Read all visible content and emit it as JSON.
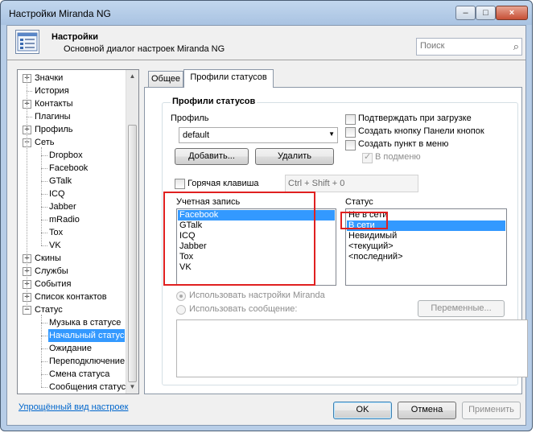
{
  "window": {
    "title": "Настройки Miranda NG",
    "minimize_glyph": "–",
    "maximize_glyph": "□",
    "close_glyph": "×"
  },
  "header": {
    "title": "Настройки",
    "subtitle": "Основной диалог настроек Miranda NG",
    "search_placeholder": "Поиск",
    "search_icon": "⌕"
  },
  "tree": {
    "items": [
      {
        "label": "Значки",
        "level": 0,
        "expander": "+"
      },
      {
        "label": "История",
        "level": 0,
        "expander": ""
      },
      {
        "label": "Контакты",
        "level": 0,
        "expander": "+"
      },
      {
        "label": "Плагины",
        "level": 0,
        "expander": ""
      },
      {
        "label": "Профиль",
        "level": 0,
        "expander": "+"
      },
      {
        "label": "Сеть",
        "level": 0,
        "expander": "−"
      },
      {
        "label": "Dropbox",
        "level": 1,
        "expander": ""
      },
      {
        "label": "Facebook",
        "level": 1,
        "expander": ""
      },
      {
        "label": "GTalk",
        "level": 1,
        "expander": ""
      },
      {
        "label": "ICQ",
        "level": 1,
        "expander": ""
      },
      {
        "label": "Jabber",
        "level": 1,
        "expander": ""
      },
      {
        "label": "mRadio",
        "level": 1,
        "expander": ""
      },
      {
        "label": "Tox",
        "level": 1,
        "expander": ""
      },
      {
        "label": "VK",
        "level": 1,
        "expander": ""
      },
      {
        "label": "Скины",
        "level": 0,
        "expander": "+"
      },
      {
        "label": "Службы",
        "level": 0,
        "expander": "+"
      },
      {
        "label": "События",
        "level": 0,
        "expander": "+"
      },
      {
        "label": "Список контактов",
        "level": 0,
        "expander": "+"
      },
      {
        "label": "Статус",
        "level": 0,
        "expander": "−"
      },
      {
        "label": "Музыка в статусе",
        "level": 1,
        "expander": ""
      },
      {
        "label": "Начальный статус",
        "level": 1,
        "expander": "",
        "selected": true
      },
      {
        "label": "Ожидание",
        "level": 1,
        "expander": ""
      },
      {
        "label": "Переподключение",
        "level": 1,
        "expander": ""
      },
      {
        "label": "Смена статуса",
        "level": 1,
        "expander": ""
      },
      {
        "label": "Сообщения статуса",
        "level": 1,
        "expander": ""
      }
    ],
    "scroll_up": "▲",
    "scroll_down": "▼"
  },
  "tabs": [
    {
      "label": "Общее",
      "active": false
    },
    {
      "label": "Профили статусов",
      "active": true
    }
  ],
  "group": {
    "title": "Профили статусов",
    "profile_label": "Профиль",
    "profile_value": "default",
    "add_button": "Добавить...",
    "delete_button": "Удалить",
    "confirm_on_load": {
      "label": "Подтверждать при загрузке",
      "checked": false
    },
    "create_toolbar_button": {
      "label": "Создать кнопку Панели кнопок",
      "checked": false
    },
    "create_menu_item": {
      "label": "Создать пункт в меню",
      "checked": false
    },
    "in_submenu": {
      "label": "В подменю",
      "checked": true,
      "disabled": true
    },
    "hotkey": {
      "label": "Горячая клавиша",
      "checked": false,
      "value": "Ctrl + Shift + 0"
    },
    "account_label": "Учетная запись",
    "accounts": [
      "Facebook",
      "GTalk",
      "ICQ",
      "Jabber",
      "Tox",
      "VK"
    ],
    "selected_account": "Facebook",
    "status_label": "Статус",
    "statuses": [
      "Не в сети",
      "В сети",
      "Невидимый",
      "<текущий>",
      "<последний>"
    ],
    "selected_status": "В сети",
    "use_miranda_settings": "Использовать настройки Miranda",
    "use_message": "Использовать сообщение:",
    "variables_button": "Переменные..."
  },
  "footer": {
    "simple_view_link": "Упрощённый вид настроек",
    "ok_button": "OK",
    "cancel_button": "Отмена",
    "apply_button": "Применить"
  },
  "colors": {
    "selection": "#3399ff",
    "highlight_box": "#e02020",
    "link": "#0066cc"
  }
}
